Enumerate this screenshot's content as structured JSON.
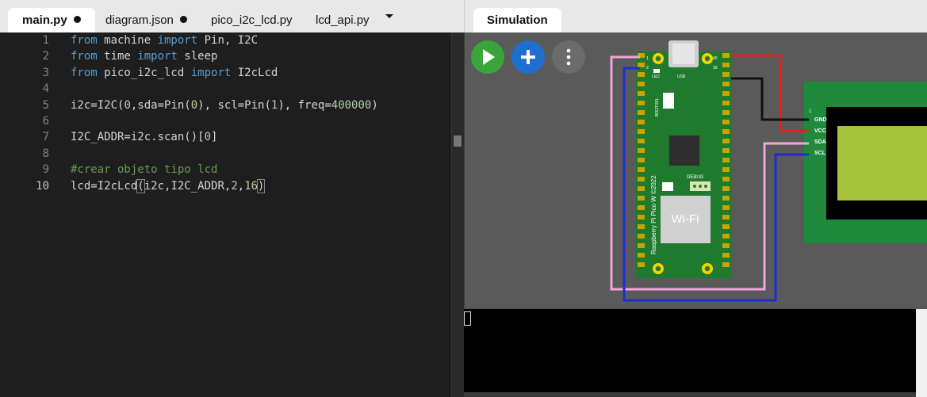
{
  "editor": {
    "tabs": [
      {
        "label": "main.py",
        "active": true,
        "modified": true
      },
      {
        "label": "diagram.json",
        "active": false,
        "modified": true
      },
      {
        "label": "pico_i2c_lcd.py",
        "active": false,
        "modified": false
      },
      {
        "label": "lcd_api.py",
        "active": false,
        "modified": false
      }
    ],
    "more_tabs_icon": "caret-down-icon",
    "lines": [
      {
        "n": "1",
        "text": "from machine import Pin, I2C"
      },
      {
        "n": "2",
        "text": "from time import sleep"
      },
      {
        "n": "3",
        "text": "from pico_i2c_lcd import I2cLcd"
      },
      {
        "n": "4",
        "text": ""
      },
      {
        "n": "5",
        "text": "i2c=I2C(0,sda=Pin(0), scl=Pin(1), freq=400000)"
      },
      {
        "n": "6",
        "text": ""
      },
      {
        "n": "7",
        "text": "I2C_ADDR=i2c.scan()[0]"
      },
      {
        "n": "8",
        "text": ""
      },
      {
        "n": "9",
        "text": "#crear objeto tipo lcd"
      },
      {
        "n": "10",
        "text": "lcd=I2cLcd(i2c,I2C_ADDR,2,16)"
      }
    ]
  },
  "simulation": {
    "tab_label": "Simulation",
    "controls": {
      "play_icon": "play-icon",
      "add_icon": "plus-icon",
      "menu_icon": "more-vertical-icon"
    },
    "board": {
      "logo_text": "Wi-Fi",
      "side_text": "Raspberry Pi Pico W ©2022",
      "bootsel": "BOOTSEL",
      "debug": "DEBUG",
      "led": "LED",
      "usb": "USB",
      "pin1": "1",
      "pin2": "2",
      "pin39": "39",
      "pin40": "40"
    },
    "lcd": {
      "pin_marker": "1",
      "pins": [
        "GND",
        "VCC",
        "SDA",
        "SCL"
      ]
    },
    "colors": {
      "canvas": "#5a5a5a",
      "board": "#1f7a2e",
      "lcd_pcb": "#1f8a3c",
      "lcd_screen": "#a7c43a",
      "wire_red": "#e0211b",
      "wire_black": "#111111",
      "wire_pink": "#f0a6d8",
      "wire_blue": "#1a2fd0",
      "play": "#3aa53a",
      "add": "#1f6fd1",
      "menu": "#6b6b6b"
    }
  }
}
